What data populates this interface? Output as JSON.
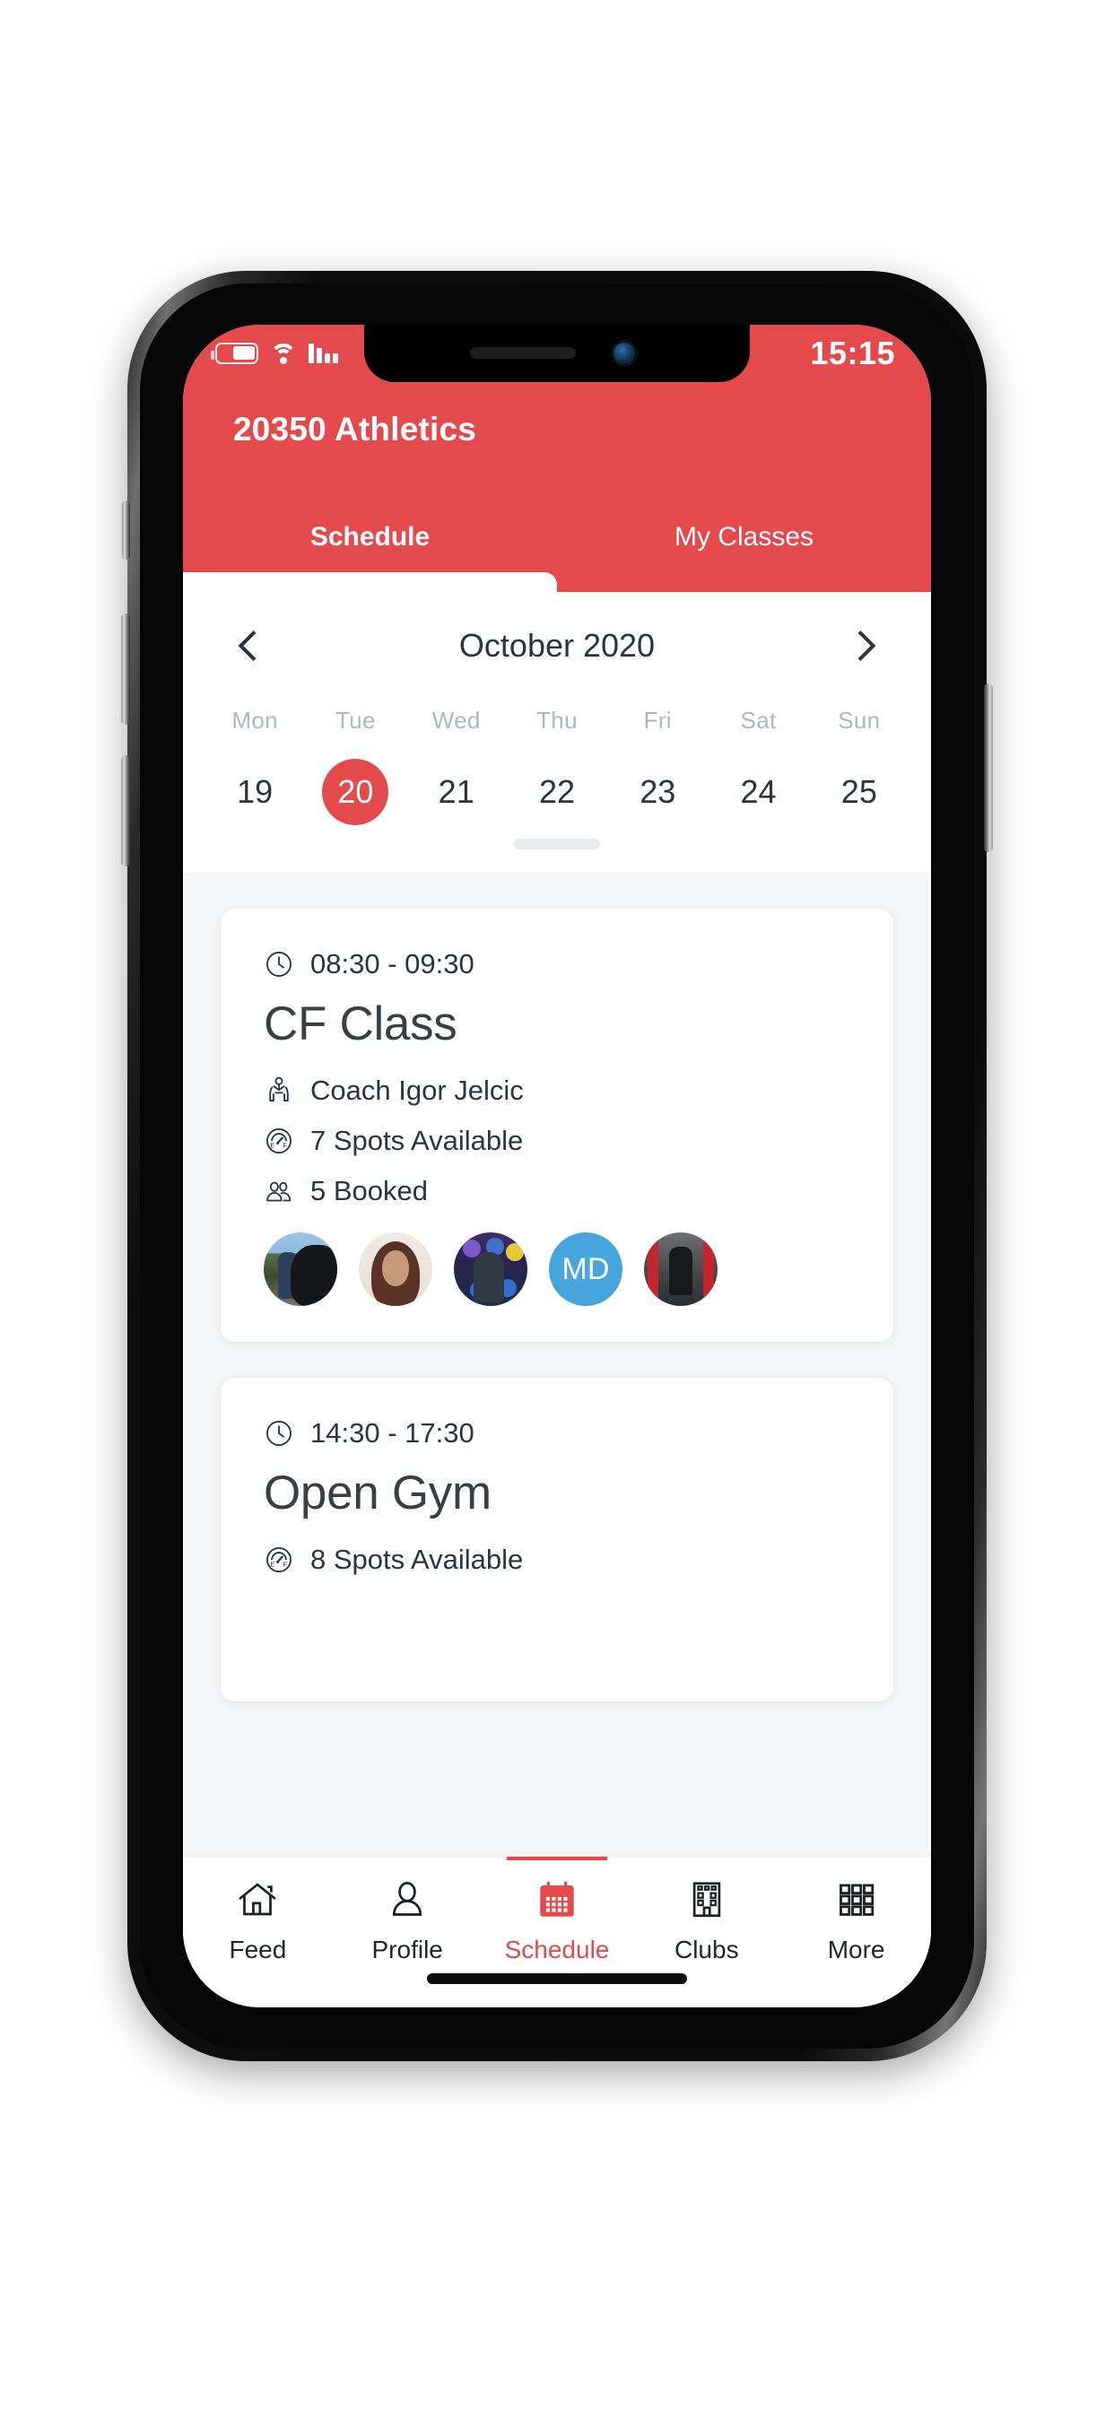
{
  "status_bar": {
    "time": "15:15",
    "battery_icon": "battery-icon",
    "wifi_icon": "wifi-icon",
    "signal_icon": "signal-icon"
  },
  "header": {
    "title": "20350 Athletics",
    "accent_color": "#e4494b",
    "tabs": [
      {
        "label": "Schedule",
        "active": true
      },
      {
        "label": "My Classes",
        "active": false
      }
    ]
  },
  "calendar": {
    "month_label": "October 2020",
    "prev_icon": "chevron-left-icon",
    "next_icon": "chevron-right-icon",
    "selected_date": "20",
    "days": [
      {
        "dow": "Mon",
        "date": "19",
        "selected": false
      },
      {
        "dow": "Tue",
        "date": "20",
        "selected": true
      },
      {
        "dow": "Wed",
        "date": "21",
        "selected": false
      },
      {
        "dow": "Thu",
        "date": "22",
        "selected": false
      },
      {
        "dow": "Fri",
        "date": "23",
        "selected": false
      },
      {
        "dow": "Sat",
        "date": "24",
        "selected": false
      },
      {
        "dow": "Sun",
        "date": "25",
        "selected": false
      }
    ]
  },
  "classes": [
    {
      "time": "08:30 - 09:30",
      "title": "CF Class",
      "coach": "Coach Igor Jelcic",
      "spots": "7 Spots Available",
      "booked": "5 Booked",
      "clock_icon": "clock-icon",
      "coach_icon": "coach-icon",
      "gauge_icon": "gauge-icon",
      "people_icon": "people-icon",
      "attendees": [
        {
          "type": "photo",
          "name": "attendee-photo-1"
        },
        {
          "type": "photo",
          "name": "attendee-photo-2"
        },
        {
          "type": "photo",
          "name": "attendee-photo-3"
        },
        {
          "type": "initials",
          "name": "attendee-initials",
          "initials": "MD",
          "color": "#48a4dd"
        },
        {
          "type": "photo",
          "name": "attendee-photo-5"
        }
      ]
    },
    {
      "time": "14:30 - 17:30",
      "title": "Open Gym",
      "spots": "8 Spots Available",
      "clock_icon": "clock-icon",
      "gauge_icon": "gauge-icon"
    }
  ],
  "bottom_nav": {
    "active_color": "#e4494b",
    "items": [
      {
        "label": "Feed",
        "icon": "home-icon",
        "active": false
      },
      {
        "label": "Profile",
        "icon": "person-icon",
        "active": false
      },
      {
        "label": "Schedule",
        "icon": "calendar-icon",
        "active": true
      },
      {
        "label": "Clubs",
        "icon": "building-icon",
        "active": false
      },
      {
        "label": "More",
        "icon": "grid-icon",
        "active": false
      }
    ]
  }
}
